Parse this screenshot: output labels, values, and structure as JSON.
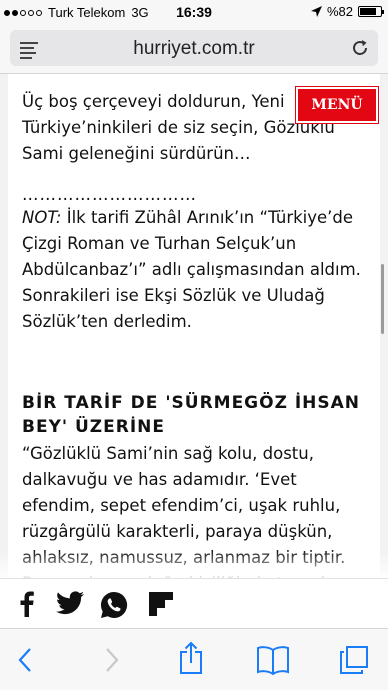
{
  "status_bar": {
    "carrier": "Turk Telekom",
    "network": "3G",
    "time": "16:39",
    "battery_text": "%82",
    "battery_level": 0.82
  },
  "browser": {
    "url": "hurriyet.com.tr"
  },
  "article": {
    "paragraph_1": "Üç boş çerçeveyi doldurun, Yeni Türkiye’ninkileri de siz seçin, Gözlüklü Sami geleneğini sürdürün…",
    "separator": "…………………………",
    "note_label": "NOT:",
    "note_text": " İlk tarifi Zühâl Arınık’ın “Türkiye’de Çizgi Roman ve Turhan Selçuk’un Abdülcanbaz’ı” adlı çalışmasından aldım. Sonrakileri ise Ekşi Sözlük ve Uludağ Sözlük’ten derledim.",
    "heading": "BİR TARİF DE 'SÜRMEGÖZ İHSAN BEY' ÜZERİNE",
    "paragraph_3": "“Gözlüklü Sami’nin sağ kolu, dostu, dalkavuğu ve has adamıdır. ‘Evet efendim, sepet efendim’ci, uşak ruhlu, rüzgârgülü karakterli, paraya düşkün, ahlaksız, namussuz, arlanmaz bir tiptir. Bunca olumsuzluğu kişiliğinde toparlama"
  },
  "menu_button": {
    "label": "MENÜ",
    "color": "#e30613"
  },
  "share_bar": {
    "icons": [
      "facebook-icon",
      "twitter-icon",
      "whatsapp-icon",
      "flipboard-icon"
    ]
  },
  "toolbar": {
    "icons": [
      "back-icon",
      "forward-icon",
      "share-icon",
      "bookmarks-icon",
      "tabs-icon"
    ],
    "accent": "#1a7cf6"
  }
}
